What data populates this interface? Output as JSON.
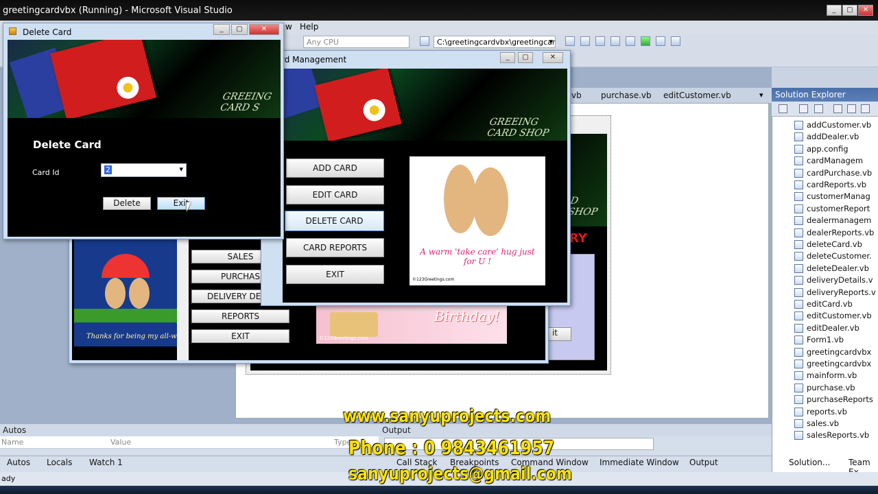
{
  "vs": {
    "title": "greetingcardvbx (Running) - Microsoft Visual Studio",
    "menu_help": "Help",
    "menu_view_fragment": "w",
    "platform": "Any CPU",
    "path": "C:\\greetingcardvbx\\greetingcar",
    "tabs": [
      "vb",
      "purchase.vb",
      "editCustomer.vb"
    ],
    "solution_explorer": "Solution Explorer",
    "files": [
      "addCustomer.vb",
      "addDealer.vb",
      "app.config",
      "cardManagem",
      "cardPurchase.vb",
      "cardReports.vb",
      "customerManag",
      "customerReport",
      "dealermanagem",
      "dealerReports.vb",
      "deleteCard.vb",
      "deleteCustomer.",
      "deleteDealer.vb",
      "deliveryDetails.v",
      "deliveryReports.v",
      "editCard.vb",
      "editCustomer.vb",
      "editDealer.vb",
      "Form1.vb",
      "greetingcardvbx",
      "greetingcardvbx",
      "mainform.vb",
      "purchase.vb",
      "purchaseReports",
      "reports.vb",
      "sales.vb",
      "salesReports.vb"
    ],
    "autos": "Autos",
    "col_name": "Name",
    "col_value": "Value",
    "col_type": "Type",
    "output": "Output",
    "bottom_tabs": [
      "Autos",
      "Locals",
      "Watch 1",
      "Call Stack",
      "Breakpoints",
      "Command Window",
      "Immediate Window",
      "Output"
    ],
    "se_tabs": [
      "Solution...",
      "Team Ex"
    ],
    "status": "ady"
  },
  "delete_card": {
    "title": "Delete Card",
    "heading": "Delete Card",
    "card_id_label": "Card Id",
    "card_id_value": "2",
    "delete_btn": "Delete",
    "exit_btn": "Exit",
    "banner_text": "GREEING CARD S"
  },
  "card_mgmt": {
    "title": "rd Management",
    "banner_text": "GREEING CARD SHOP",
    "buttons": [
      "ADD CARD",
      "EDIT CARD",
      "DELETE CARD",
      "CARD REPORTS",
      "EXIT"
    ],
    "image_text": "A warm 'take care' hug just for U !",
    "image_credit": "©123Greetings.com"
  },
  "main_form": {
    "buttons": [
      "SALES",
      "PURCHASE",
      "DELIVERY DET",
      "REPORTS",
      "EXIT"
    ],
    "thanks_text": "Thanks for being my all-w",
    "birthday_text": "Birthday!",
    "birthday_credit": "©123Greetings.com"
  },
  "background_form": {
    "banner_text": "D SHOP",
    "red_text": "RY",
    "exit_fragment": "it"
  },
  "watermark": {
    "site": "www.sanyuprojects.com",
    "phone": "Phone : 0 9843461957",
    "email": "sanyuprojects@gmail.com"
  }
}
